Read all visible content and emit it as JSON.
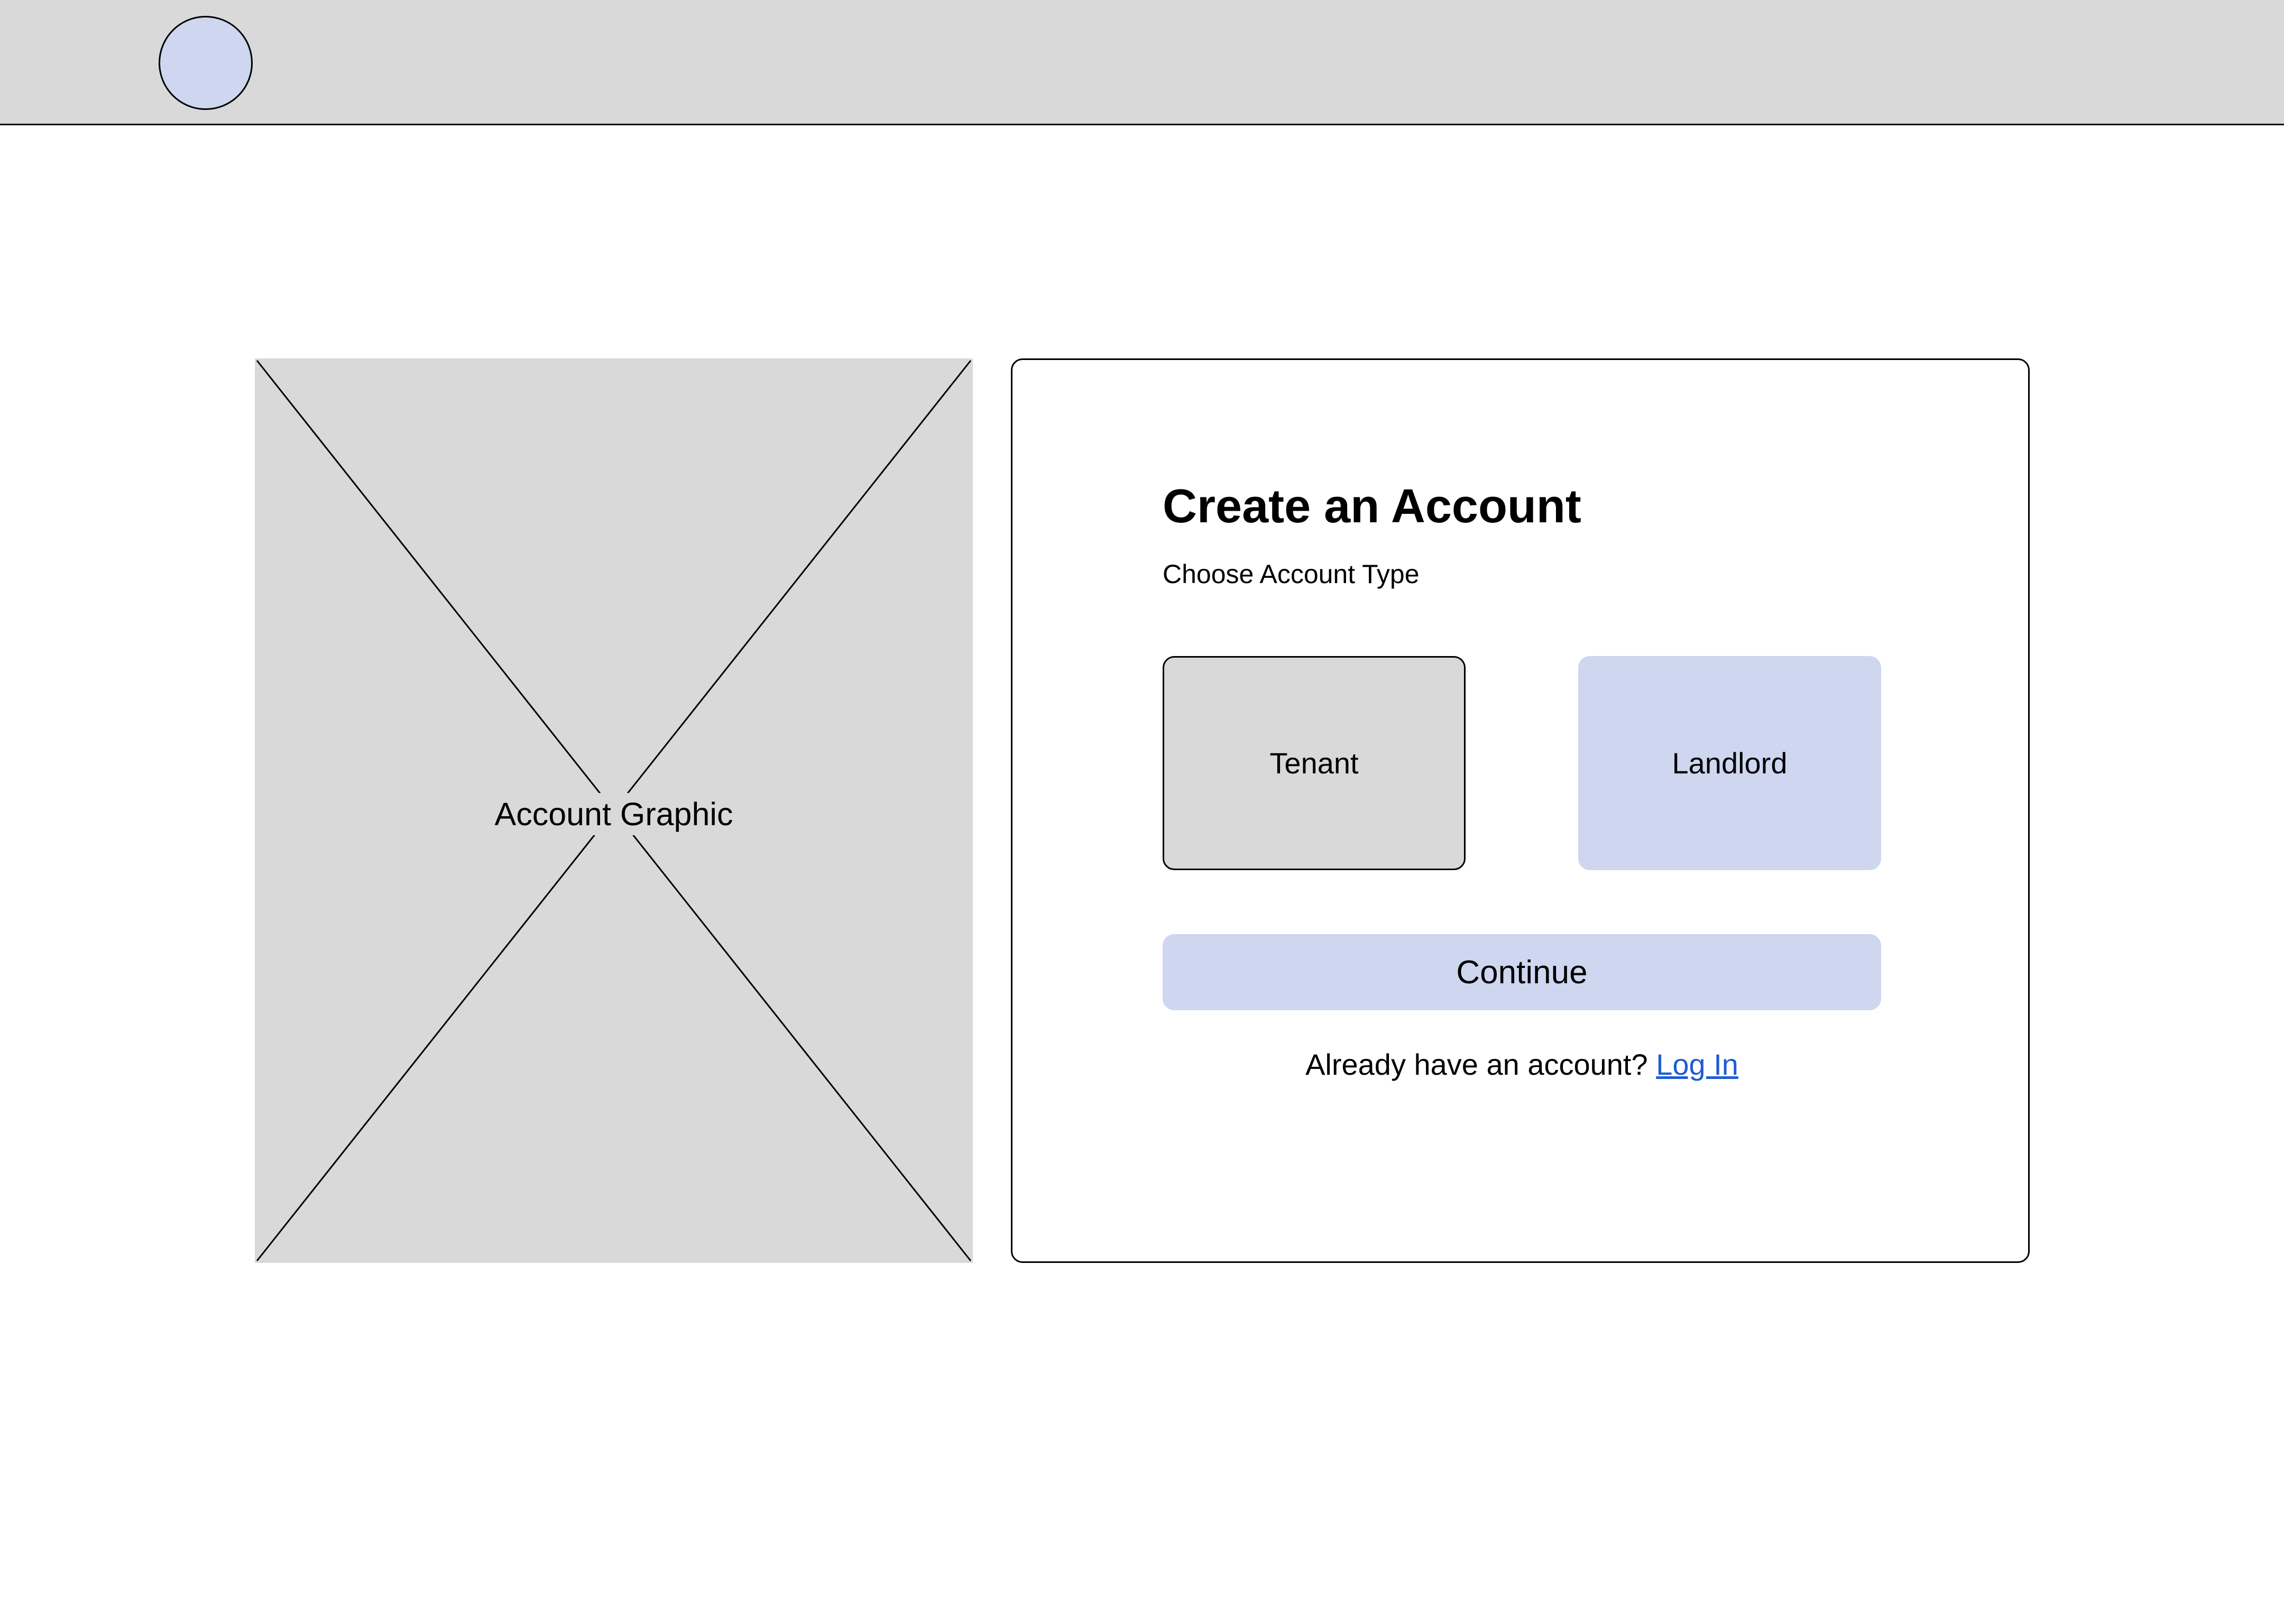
{
  "header": {
    "avatar": "avatar-circle"
  },
  "graphic": {
    "label": "Account Graphic"
  },
  "signup": {
    "title": "Create an Account",
    "subtitle": "Choose Account Type",
    "account_types": [
      {
        "label": "Tenant"
      },
      {
        "label": "Landlord"
      }
    ],
    "continue_label": "Continue",
    "login_prompt": "Already have an account?",
    "login_link": "Log In"
  },
  "colors": {
    "placeholder_gray": "#d9d9d9",
    "accent_blue": "#ced7ef",
    "link_blue": "#1f5bd6"
  }
}
